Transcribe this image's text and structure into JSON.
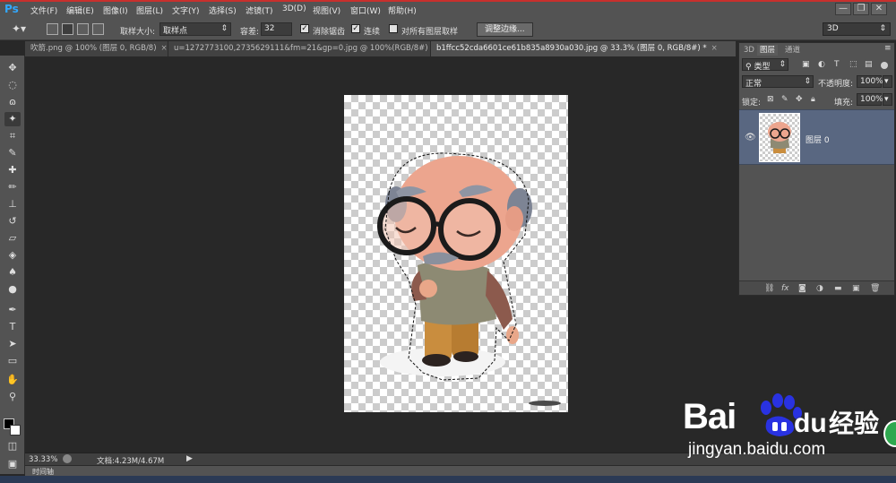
{
  "app": {
    "logo": "Ps"
  },
  "menu": [
    {
      "label": "文件(F)"
    },
    {
      "label": "编辑(E)"
    },
    {
      "label": "图像(I)"
    },
    {
      "label": "图层(L)"
    },
    {
      "label": "文字(Y)"
    },
    {
      "label": "选择(S)"
    },
    {
      "label": "滤镜(T)"
    },
    {
      "label": "3D(D)"
    },
    {
      "label": "视图(V)"
    },
    {
      "label": "窗口(W)"
    },
    {
      "label": "帮助(H)"
    }
  ],
  "window_controls": {
    "minimize": "—",
    "restore": "❐",
    "close": "✕"
  },
  "options": {
    "sample_size_label": "取样大小:",
    "sample_size_value": "取样点",
    "tolerance_label": "容差:",
    "tolerance_value": "32",
    "antialias_label": "消除锯齿",
    "contiguous_label": "连续",
    "sample_all_label": "对所有图层取样",
    "refine_edge_button": "调整边缘..."
  },
  "workspace": {
    "value": "3D"
  },
  "tabs": [
    {
      "label": "吹箭.png @ 100% (图层 0, RGB/8)",
      "close": "×"
    },
    {
      "label": "u=1272773100,2735629111&fm=21&gp=0.jpg @ 100%(RGB/8#)",
      "close": "×"
    },
    {
      "label": "b1ffcc52cda6601ce61b835a8930a030.jpg @ 33.3% (图层 0, RGB/8#) *",
      "close": "×"
    }
  ],
  "layers_panel": {
    "tabs": [
      {
        "label": "3D"
      },
      {
        "label": "图层"
      },
      {
        "label": "通道"
      }
    ],
    "filter_label": "类型",
    "blend_mode": "正常",
    "opacity_label": "不透明度:",
    "opacity_value": "100%",
    "lock_label": "锁定:",
    "fill_label": "填充:",
    "fill_value": "100%",
    "layers": [
      {
        "name": "图层 0",
        "visible": true
      }
    ],
    "footer_icons": [
      "link-icon",
      "fx-icon",
      "mask-icon",
      "adjustment-icon",
      "folder-icon",
      "new-layer-icon",
      "trash-icon"
    ]
  },
  "status": {
    "zoom": "33.33%",
    "doc_info": "文档:4.23M/4.67M"
  },
  "timeline": {
    "label": "时间轴"
  },
  "watermark": {
    "brand": "Bai",
    "brand2": "du",
    "cn": "经验",
    "url": "jingyan.baidu.com"
  },
  "colors": {
    "accent_red": "#c8302d",
    "ps_blue": "#31a8ff",
    "layer_selected": "#596781",
    "baidu_blue": "#2932e1"
  }
}
